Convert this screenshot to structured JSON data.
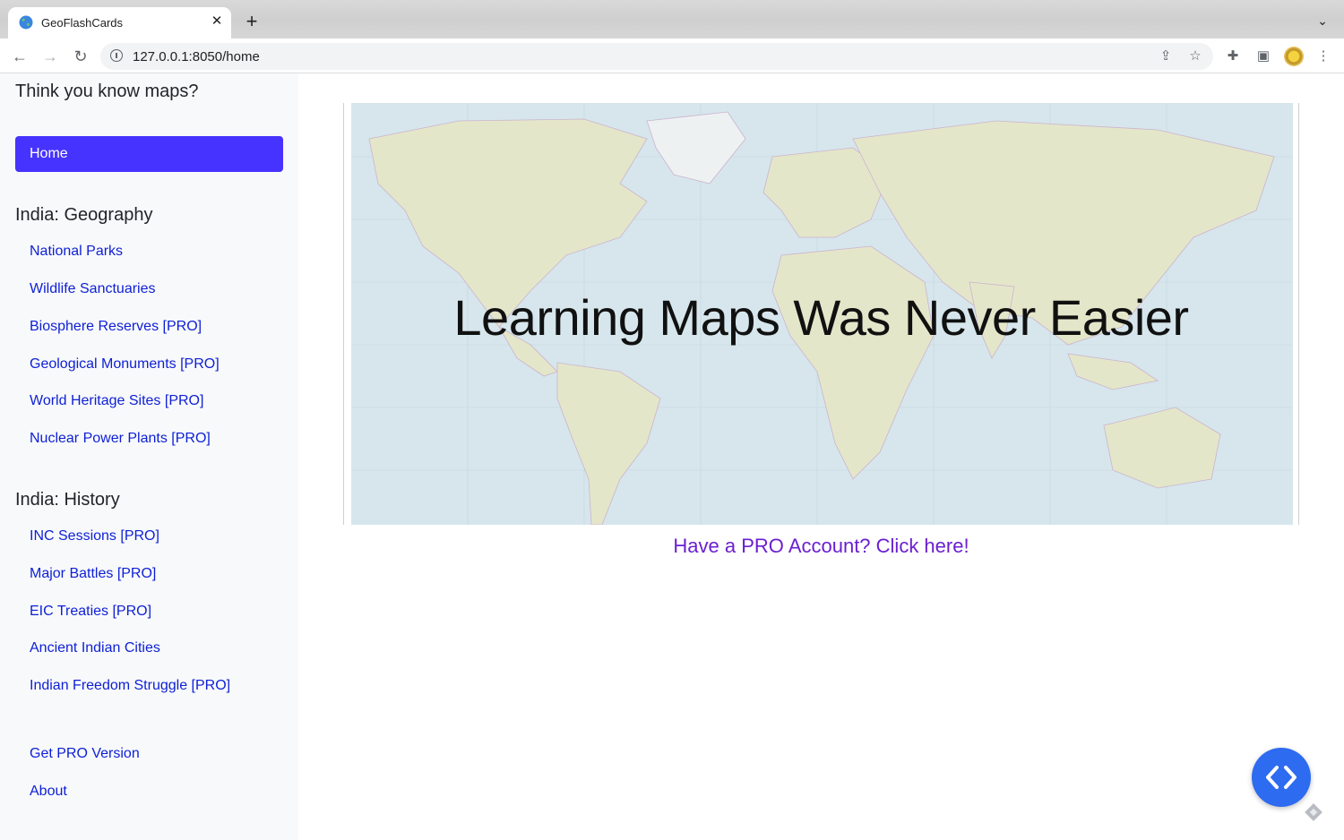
{
  "browser": {
    "tab_title": "GeoFlashCards",
    "url": "127.0.0.1:8050/home"
  },
  "sidebar": {
    "tagline": "Think you know maps?",
    "home_label": "Home",
    "sections": [
      {
        "title": "India: Geography",
        "links": [
          "National Parks",
          "Wildlife Sanctuaries",
          "Biosphere Reserves [PRO]",
          "Geological Monuments [PRO]",
          "World Heritage Sites [PRO]",
          "Nuclear Power Plants [PRO]"
        ]
      },
      {
        "title": "India: History",
        "links": [
          "INC Sessions [PRO]",
          "Major Battles [PRO]",
          "EIC Treaties [PRO]",
          "Ancient Indian Cities",
          "Indian Freedom Struggle [PRO]"
        ]
      }
    ],
    "footer_links": [
      "Get PRO Version",
      "About"
    ]
  },
  "main": {
    "hero_text": "Learning Maps Was Never Easier",
    "pro_link": "Have a PRO Account? Click here!"
  },
  "colors": {
    "accent": "#4733ff",
    "link": "#0d1fd6",
    "pro_link": "#6a1fd1",
    "sidebar_bg": "#f8f9fa",
    "fab": "#2d6bf0"
  }
}
